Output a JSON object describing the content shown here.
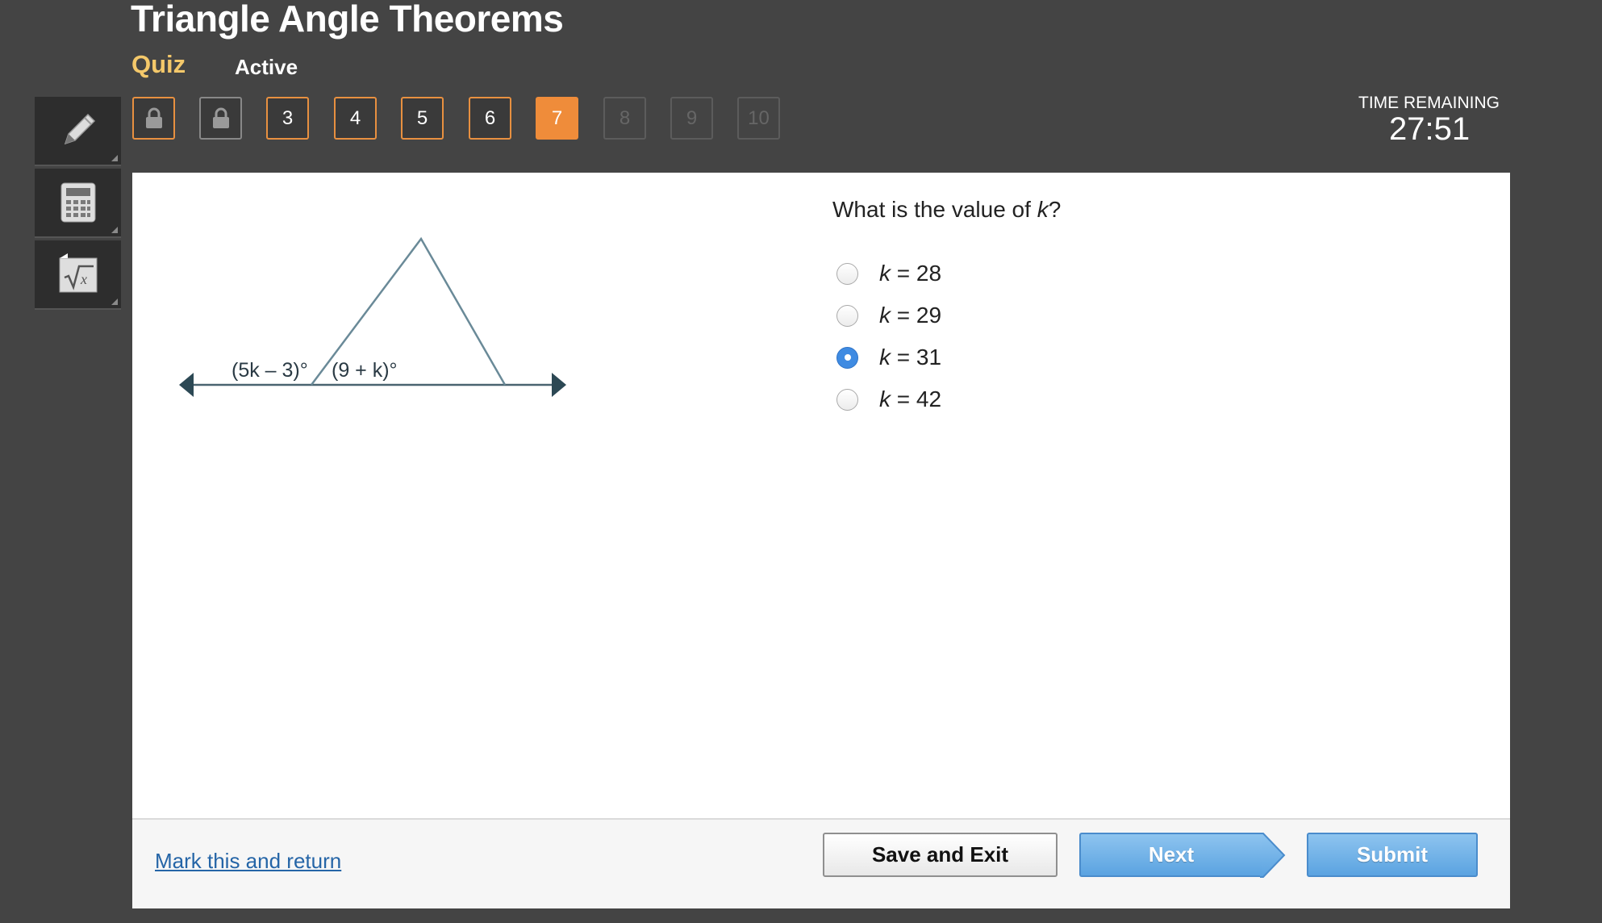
{
  "header": {
    "title": "Triangle Angle Theorems",
    "quiz_label": "Quiz",
    "status": "Active"
  },
  "question_nav": [
    {
      "label": "",
      "state": "done",
      "icon": "lock-icon"
    },
    {
      "label": "",
      "state": "locked",
      "icon": "lock-icon"
    },
    {
      "label": "3",
      "state": "done"
    },
    {
      "label": "4",
      "state": "done"
    },
    {
      "label": "5",
      "state": "done"
    },
    {
      "label": "6",
      "state": "done"
    },
    {
      "label": "7",
      "state": "current"
    },
    {
      "label": "8",
      "state": "disabled"
    },
    {
      "label": "9",
      "state": "disabled"
    },
    {
      "label": "10",
      "state": "disabled"
    }
  ],
  "timer": {
    "label": "TIME REMAINING",
    "value": "27:51"
  },
  "tools": [
    {
      "icon": "pencil-icon"
    },
    {
      "icon": "calculator-icon"
    },
    {
      "icon": "formula-sqrt-icon"
    }
  ],
  "diagram": {
    "exterior_angle_label": "(5k – 3)°",
    "interior_angle_label": "(9 + k)°"
  },
  "question": {
    "prefix": "What is the value of ",
    "variable": "k",
    "suffix": "?",
    "options": [
      {
        "variable": "k",
        "rest": " = 28",
        "selected": false
      },
      {
        "variable": "k",
        "rest": " = 29",
        "selected": false
      },
      {
        "variable": "k",
        "rest": " = 31",
        "selected": true
      },
      {
        "variable": "k",
        "rest": " = 42",
        "selected": false
      }
    ]
  },
  "footer": {
    "mark_link": "Mark this and return",
    "save_label": "Save and Exit",
    "next_label": "Next",
    "submit_label": "Submit"
  },
  "colors": {
    "background": "#444444",
    "accent_orange": "#ef8c3a",
    "quiz_yellow": "#f4c86a",
    "button_blue": "#5ba3e1",
    "radio_selected": "#3f8be2"
  }
}
